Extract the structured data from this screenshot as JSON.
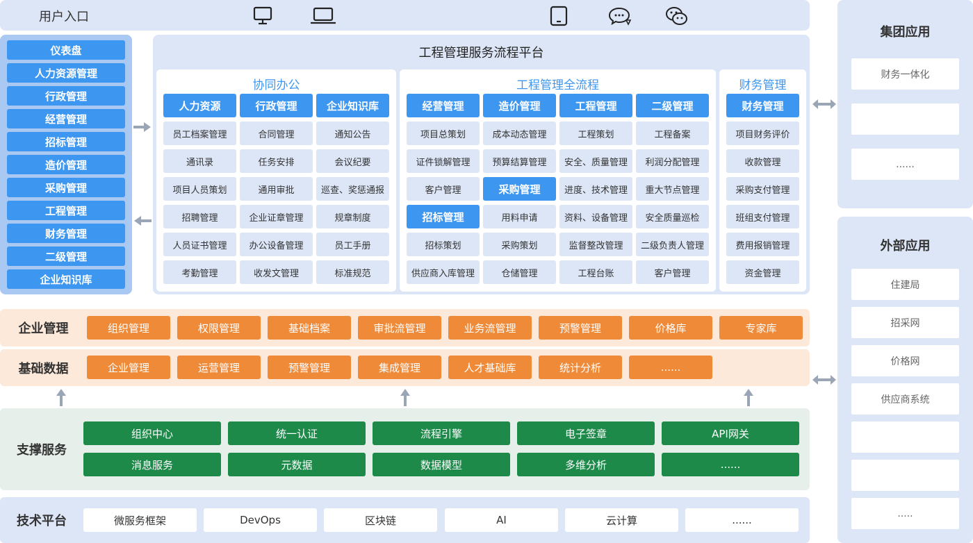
{
  "user_entry": {
    "title": "用户入口"
  },
  "left_nav": {
    "items": [
      "仪表盘",
      "人力资源管理",
      "行政管理",
      "经营管理",
      "招标管理",
      "造价管理",
      "采购管理",
      "工程管理",
      "财务管理",
      "二级管理",
      "企业知识库"
    ]
  },
  "platform": {
    "title": "工程管理服务流程平台",
    "panels": [
      {
        "title": "协同办公",
        "columns": [
          {
            "header": "人力资源",
            "items": [
              "员工档案管理",
              "通讯录",
              "项目人员策划",
              "招聘管理",
              "人员证书管理",
              "考勤管理"
            ]
          },
          {
            "header": "行政管理",
            "items": [
              "合同管理",
              "任务安排",
              "通用审批",
              "企业证章管理",
              "办公设备管理",
              "收发文管理"
            ]
          },
          {
            "header": "企业知识库",
            "items": [
              "通知公告",
              "会议纪要",
              "巡查、奖惩通报",
              "规章制度",
              "员工手册",
              "标准规范"
            ]
          }
        ]
      },
      {
        "title": "工程管理全流程",
        "columns": [
          {
            "header": "经营管理",
            "items": [
              "项目总策划",
              "证件锁解管理",
              "客户管理",
              "招标管理",
              "招标策划",
              "供应商入库管理"
            ]
          },
          {
            "header": "造价管理",
            "items": [
              "成本动态管理",
              "预算结算管理",
              "采购管理",
              "用料申请",
              "采购策划",
              "仓储管理"
            ]
          },
          {
            "header": "工程管理",
            "items": [
              "工程策划",
              "安全、质量管理",
              "进度、技术管理",
              "资料、设备管理",
              "监督整改管理",
              "工程台账"
            ]
          },
          {
            "header": "二级管理",
            "items": [
              "工程备案",
              "利润分配管理",
              "重大节点管理",
              "安全质量巡检",
              "二级负责人管理",
              "客户管理"
            ]
          }
        ]
      },
      {
        "title": "财务管理",
        "columns": [
          {
            "header": "财务管理",
            "items": [
              "项目财务评价",
              "收款管理",
              "采购支付管理",
              "班组支付管理",
              "费用报销管理",
              "资金管理"
            ]
          }
        ]
      }
    ]
  },
  "group_apps": {
    "title": "集团应用",
    "items": [
      "财务一体化",
      "",
      "......"
    ]
  },
  "external_apps": {
    "title": "外部应用",
    "items": [
      "住建局",
      "招采网",
      "价格网",
      "供应商系统",
      "",
      "",
      ".....​"
    ]
  },
  "enterprise_mgmt": {
    "label": "企业管理",
    "items": [
      "组织管理",
      "权限管理",
      "基础档案",
      "审批流管理",
      "业务流管理",
      "预警管理",
      "价格库",
      "专家库"
    ]
  },
  "base_data": {
    "label": "基础数据",
    "items": [
      "企业管理",
      "运营管理",
      "预警管理",
      "集成管理",
      "人才基础库",
      "统计分析",
      "......"
    ]
  },
  "support_services": {
    "label": "支撑服务",
    "rows": [
      [
        "组织中心",
        "统一认证",
        "流程引擎",
        "电子签章",
        "API网关"
      ],
      [
        "消息服务",
        "元数据",
        "数据模型",
        "多维分析",
        "......"
      ]
    ]
  },
  "tech_platform": {
    "label": "技术平台",
    "items": [
      "微服务框架",
      "DevOps",
      "区块链",
      "AI",
      "云计算",
      "......"
    ]
  },
  "icons": {
    "devices": [
      "desktop-icon",
      "laptop-icon",
      "tablet-icon",
      "chat-bubble-icon",
      "wechat-icon"
    ]
  },
  "colors": {
    "blue": "#3d96ef",
    "light_blue": "#dde6f7",
    "orange": "#ef8a39",
    "green": "#1d8a4a",
    "peach_bg": "#fde9da",
    "mint_bg": "#e6efe9"
  }
}
